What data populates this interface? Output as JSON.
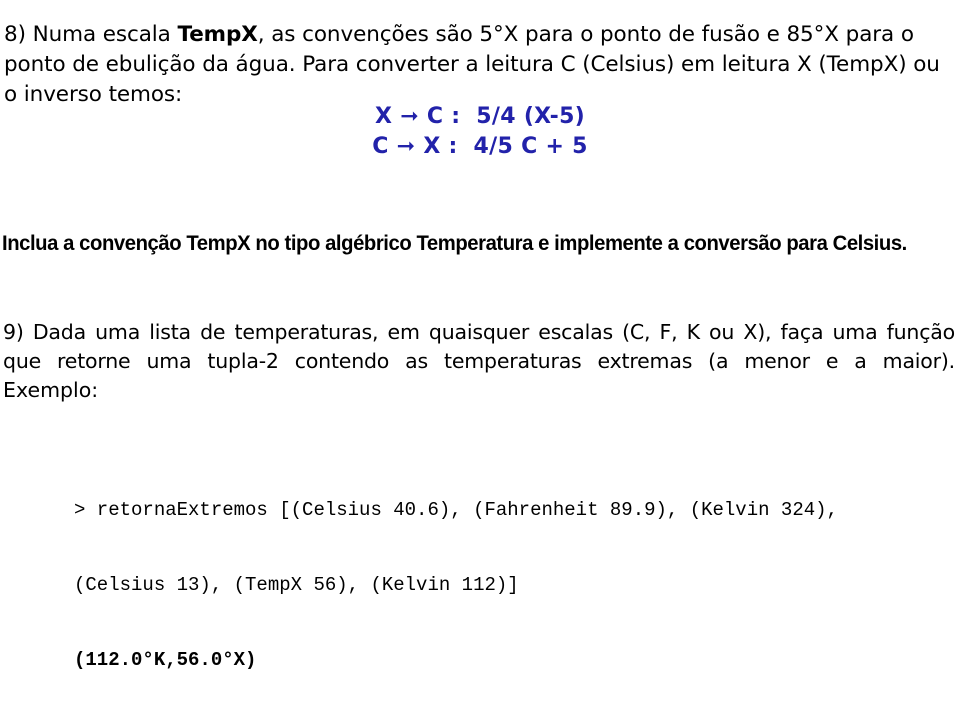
{
  "document": {
    "language": "pt-BR",
    "background_color": "#ffffff",
    "text_color": "#000000",
    "accent_color": "#2222AA"
  },
  "exercise_8": {
    "intro_part_1": "8) Numa escala ",
    "intro_bold": "Temp",
    "intro_bold_tail": "X",
    "intro_part_2": ", as convenções são 5",
    "intro_degree_1": "°",
    "intro_part_3": "X para o ponto de fusão e 85",
    "intro_degree_2": "°",
    "intro_part_4": "X para o ponto de ebulição da água. Para converter a leitura C (Celsius) em leitura X (TempX) ou o inverso temos:",
    "full_text": "8) Numa escala TempX, as convenções são 5°X para o ponto de fusão e 85°X para o ponto de ebulição da água. Para converter a leitura C (Celsius) em leitura X (TempX) ou o inverso temos:",
    "formulas": [
      {
        "from": "X",
        "arrow": "➞",
        "to": "C",
        "separator": " :  ",
        "expression": "5/4 (X-5)",
        "text": "X ➞ C :  5/4 (X-5)"
      },
      {
        "from": "C",
        "arrow": "➞",
        "to": "X",
        "separator": " :  ",
        "expression": "4/5 C + 5",
        "text": "C ➞ X :  4/5 C + 5"
      }
    ],
    "instruction": "Inclua a convenção TempX no tipo algébrico Temperatura e implemente a conversão para Celsius."
  },
  "exercise_9": {
    "statement_lines": [
      "9) Dada uma lista de temperaturas, em quaisquer escalas (C, F, K ou X), faça uma função",
      "que retorne uma tupla-2 contendo as temperaturas extremas (a menor e a maior)."
    ],
    "statement_full": "9) Dada uma lista de temperaturas, em quaisquer escalas (C, F, K ou X), faça uma função que retorne uma tupla-2 contendo as temperaturas extremas (a menor e a maior).",
    "example_label": "Exemplo:",
    "code_lines": [
      {
        "text": "> retornaExtremos [(Celsius 40.6), (Fahrenheit 89.9), (Kelvin 324),",
        "bold": false
      },
      {
        "text": "(Celsius 13), (TempX 56), (Kelvin 112)]",
        "bold": false
      },
      {
        "text": "(112.0°K,56.0°X)",
        "bold": true
      }
    ],
    "code_prompt_symbol": ">",
    "function_name": "retornaExtremos",
    "input_temperatures": [
      {
        "scale": "Celsius",
        "value": "40.6"
      },
      {
        "scale": "Fahrenheit",
        "value": "89.9"
      },
      {
        "scale": "Kelvin",
        "value": "324"
      },
      {
        "scale": "Celsius",
        "value": "13"
      },
      {
        "scale": "TempX",
        "value": "56"
      },
      {
        "scale": "Kelvin",
        "value": "112"
      }
    ],
    "result": "(112.0°K,56.0°X)"
  }
}
